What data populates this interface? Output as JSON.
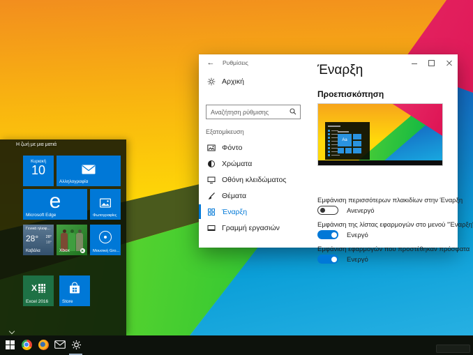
{
  "settings_window": {
    "titlebar": {
      "title": "Ρυθμίσεις",
      "back_glyph": "←"
    },
    "sidebar": {
      "home_label": "Αρχική",
      "search_placeholder": "Αναζήτηση ρύθμισης",
      "section_label": "Εξατομίκευση",
      "items": [
        {
          "label": "Φόντο"
        },
        {
          "label": "Χρώματα"
        },
        {
          "label": "Οθόνη κλειδώματος"
        },
        {
          "label": "Θέματα"
        },
        {
          "label": "Έναρξη",
          "selected": true
        },
        {
          "label": "Γραμμή εργασιών"
        }
      ]
    },
    "content": {
      "page_title": "Έναρξη",
      "preview_heading": "Προεπισκόπηση",
      "preview_tile_label": "Aa",
      "toggles": [
        {
          "label": "Εμφάνιση περισσότερων πλακιδίων στην Έναρξη",
          "state_label": "Ανενεργό",
          "on": false
        },
        {
          "label": "Εμφάνιση της λίστας εφαρμογών στο μενού \"Έναρξη\"",
          "state_label": "Ενεργό",
          "on": true
        },
        {
          "label": "Εμφάνιση εφαρμογών που προστέθηκαν πρόσφατα",
          "state_label": "Ενεργό",
          "on": true
        }
      ]
    }
  },
  "start_menu": {
    "group_label": "Η ζωή με μια ματιά",
    "tiles": {
      "calendar": {
        "weekday": "Κυριακή",
        "date": "10"
      },
      "mail": {
        "label": "Αλληλογραφία"
      },
      "edge": {
        "logo_letter": "e",
        "label": "Microsoft Edge"
      },
      "photos": {
        "label": "Φωτογραφίες"
      },
      "weather": {
        "condition": "Γενικά ηλιοφ...",
        "temperature": "28°",
        "high": "28°",
        "low": "18°",
        "location": "Καβάλα"
      },
      "xbox": {
        "label": "Xbox"
      },
      "music": {
        "label": "Μουσική Gro..."
      },
      "excel": {
        "logo_letter": "X",
        "label": "Excel 2016"
      },
      "store": {
        "label": "Store"
      }
    }
  },
  "colors": {
    "accent": "#0078d7",
    "tile_blue": "#0078d7",
    "excel_green": "#1e7145",
    "wallpaper_yellow": "#ffdf05",
    "wallpaper_pink": "#db0e50",
    "wallpaper_blue": "#1566c0",
    "wallpaper_green": "#3ecb31"
  }
}
